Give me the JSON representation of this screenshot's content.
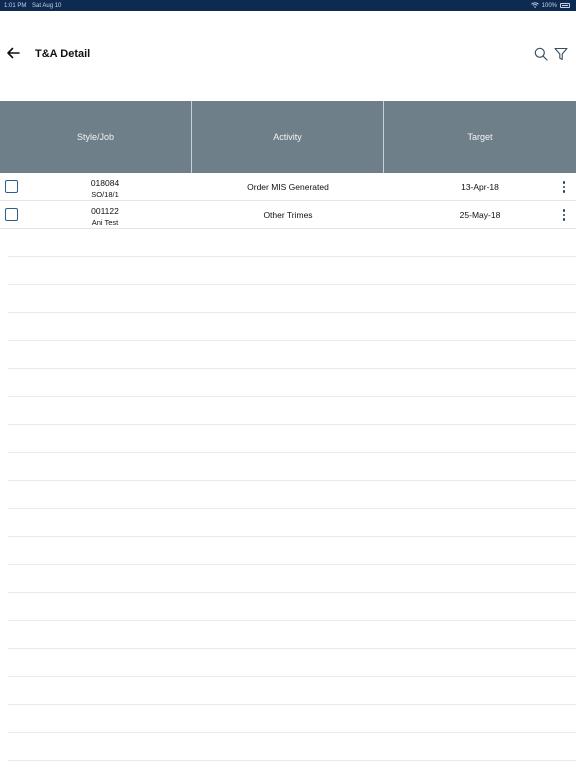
{
  "status_bar": {
    "time": "1:01 PM",
    "date": "Sat Aug 10",
    "battery": "100%",
    "wifi_icon": "wifi-icon",
    "battery_icon": "battery-icon"
  },
  "nav": {
    "title": "T&A Detail",
    "back_icon": "arrow-left-icon",
    "search_icon": "search-icon",
    "filter_icon": "filter-icon"
  },
  "table": {
    "columns": [
      "Style/Job",
      "Activity",
      "Target"
    ],
    "rows": [
      {
        "style": "018084",
        "job": "SO/18/1",
        "activity": "Order MIS Generated",
        "target": "13-Apr-18",
        "checked": false
      },
      {
        "style": "001122",
        "job": "Ani Test",
        "activity": "Other Trimes",
        "target": "25-May-18",
        "checked": false
      }
    ]
  },
  "colors": {
    "header_bg": "#6e7f89",
    "status_bg": "#0d2a52",
    "accent": "#2f5e8c"
  }
}
